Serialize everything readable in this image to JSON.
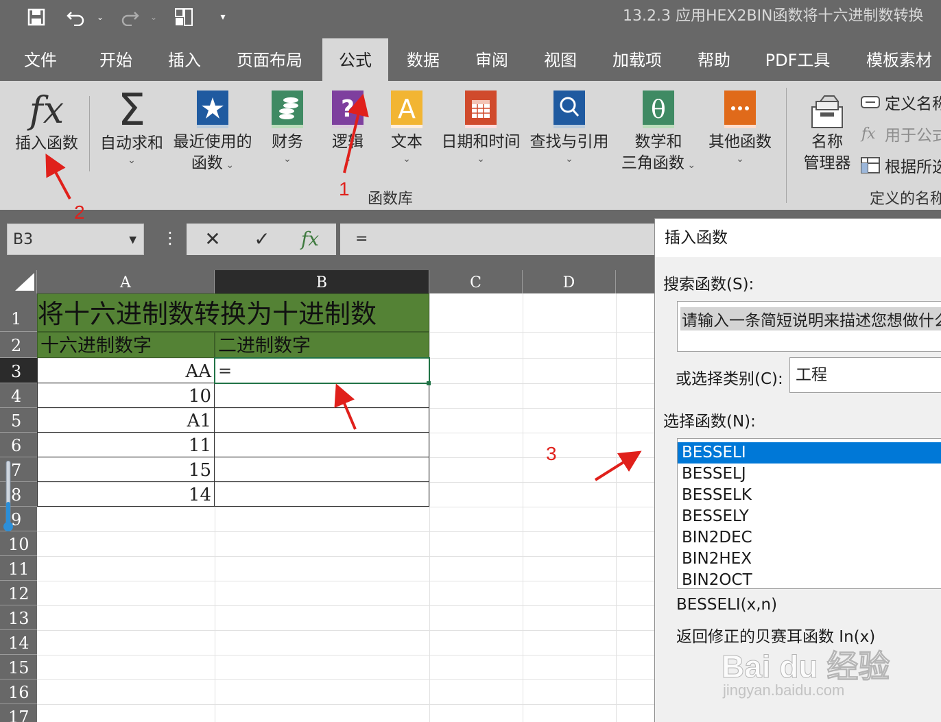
{
  "titlebar": {
    "title": "13.2.3   应用HEX2BIN函数将十六进制数转换"
  },
  "tabs": [
    {
      "label": "文件"
    },
    {
      "label": "开始"
    },
    {
      "label": "插入"
    },
    {
      "label": "页面布局"
    },
    {
      "label": "公式"
    },
    {
      "label": "数据"
    },
    {
      "label": "审阅"
    },
    {
      "label": "视图"
    },
    {
      "label": "加载项"
    },
    {
      "label": "帮助"
    },
    {
      "label": "PDF工具"
    },
    {
      "label": "模板素材"
    }
  ],
  "ribbon": {
    "insert_function": "插入函数",
    "autosum": "自动求和",
    "recent_line1": "最近使用的",
    "recent_line2": "函数",
    "financial": "财务",
    "logical": "逻辑",
    "text": "文本",
    "datetime": "日期和时间",
    "lookup": "查找与引用",
    "math_line1": "数学和",
    "math_line2": "三角函数",
    "more": "其他函数",
    "group_library": "函数库",
    "name_manager_line1": "名称",
    "name_manager_line2": "管理器",
    "define_name": "定义名称",
    "use_in_formula": "用于公式",
    "create_from_selection": "根据所选",
    "group_defined_names": "定义的名称"
  },
  "formula_bar": {
    "name_box": "B3",
    "fx_label": "fx",
    "formula": "="
  },
  "sheet": {
    "columns": [
      "A",
      "B",
      "C",
      "D"
    ],
    "rows": [
      "1",
      "2",
      "3",
      "4",
      "5",
      "6",
      "7",
      "8",
      "9",
      "10",
      "11",
      "12",
      "13",
      "14",
      "15",
      "16",
      "17"
    ],
    "title": "将十六进制数转换为十进制数",
    "header_hex": "十六进制数字",
    "header_bin": "二进制数字",
    "hex_values": [
      "AA",
      "10",
      "A1",
      "11",
      "15",
      "14"
    ],
    "active_cell_value": "="
  },
  "dialog": {
    "title": "插入函数",
    "search_label": "搜索函数(S):",
    "search_placeholder": "请输入一条简短说明来描述您想做什么",
    "category_label": "或选择类别(C):",
    "category_value": "工程",
    "select_label": "选择函数(N):",
    "functions": [
      "BESSELI",
      "BESSELJ",
      "BESSELK",
      "BESSELY",
      "BIN2DEC",
      "BIN2HEX",
      "BIN2OCT"
    ],
    "signature": "BESSELI(x,n)",
    "description": "返回修正的贝赛耳函数 In(x)"
  },
  "annotations": {
    "n1": "1",
    "n2": "2",
    "n3": "3",
    "color": "#e0201b"
  },
  "watermark": {
    "brand": "Bai du 经验",
    "url": "jingyan.baidu.com"
  },
  "colors": {
    "chrome_dark": "#686868",
    "ribbon": "#d8d8d8",
    "sheet_fill_green": "#548235",
    "selection_blue": "#0078d7",
    "active_border_green": "#217346"
  }
}
